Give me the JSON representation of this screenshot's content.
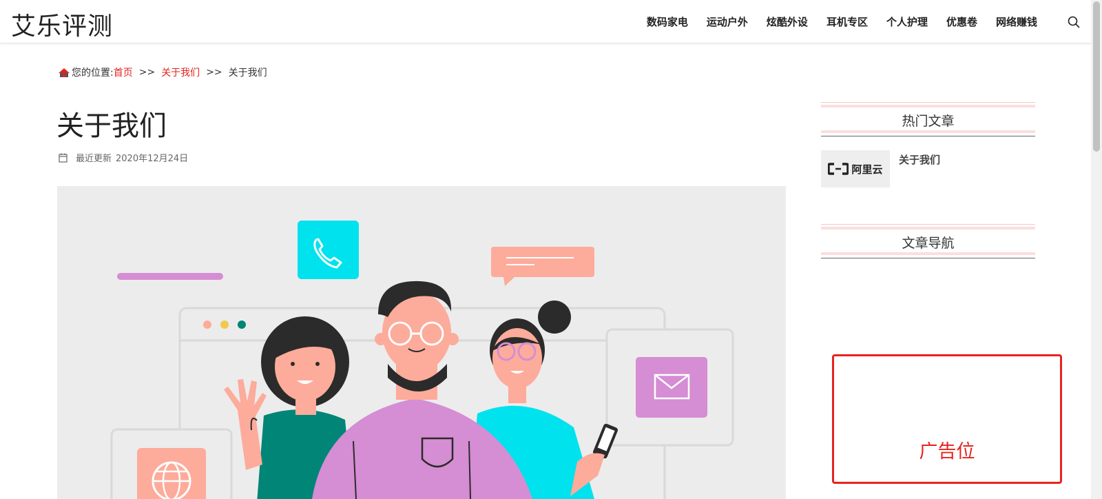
{
  "header": {
    "site_title": "艾乐评测",
    "nav": [
      "数码家电",
      "运动户外",
      "炫酷外设",
      "耳机专区",
      "个人护理",
      "优惠卷",
      "网络赚钱"
    ],
    "search_icon": "search-icon"
  },
  "breadcrumb": {
    "prefix": "您的位置:",
    "home": "首页",
    "sep": ">>",
    "parent": "关于我们",
    "current": "关于我们"
  },
  "article": {
    "title": "关于我们",
    "meta_label": "最近更新",
    "date": "2020年12月24日",
    "hero_colors": {
      "bg": "#ececec",
      "cyan": "#00e2ee",
      "purple": "#d58dd3",
      "peach": "#fdab9b",
      "teal": "#008577"
    }
  },
  "sidebar": {
    "popular_title": "热门文章",
    "popular_items": [
      {
        "thumb_text": "阿里云",
        "title": "关于我们"
      }
    ],
    "nav_title": "文章导航",
    "ad_text": "广告位"
  },
  "colors": {
    "accent": "#e6231e",
    "text": "#333333"
  }
}
